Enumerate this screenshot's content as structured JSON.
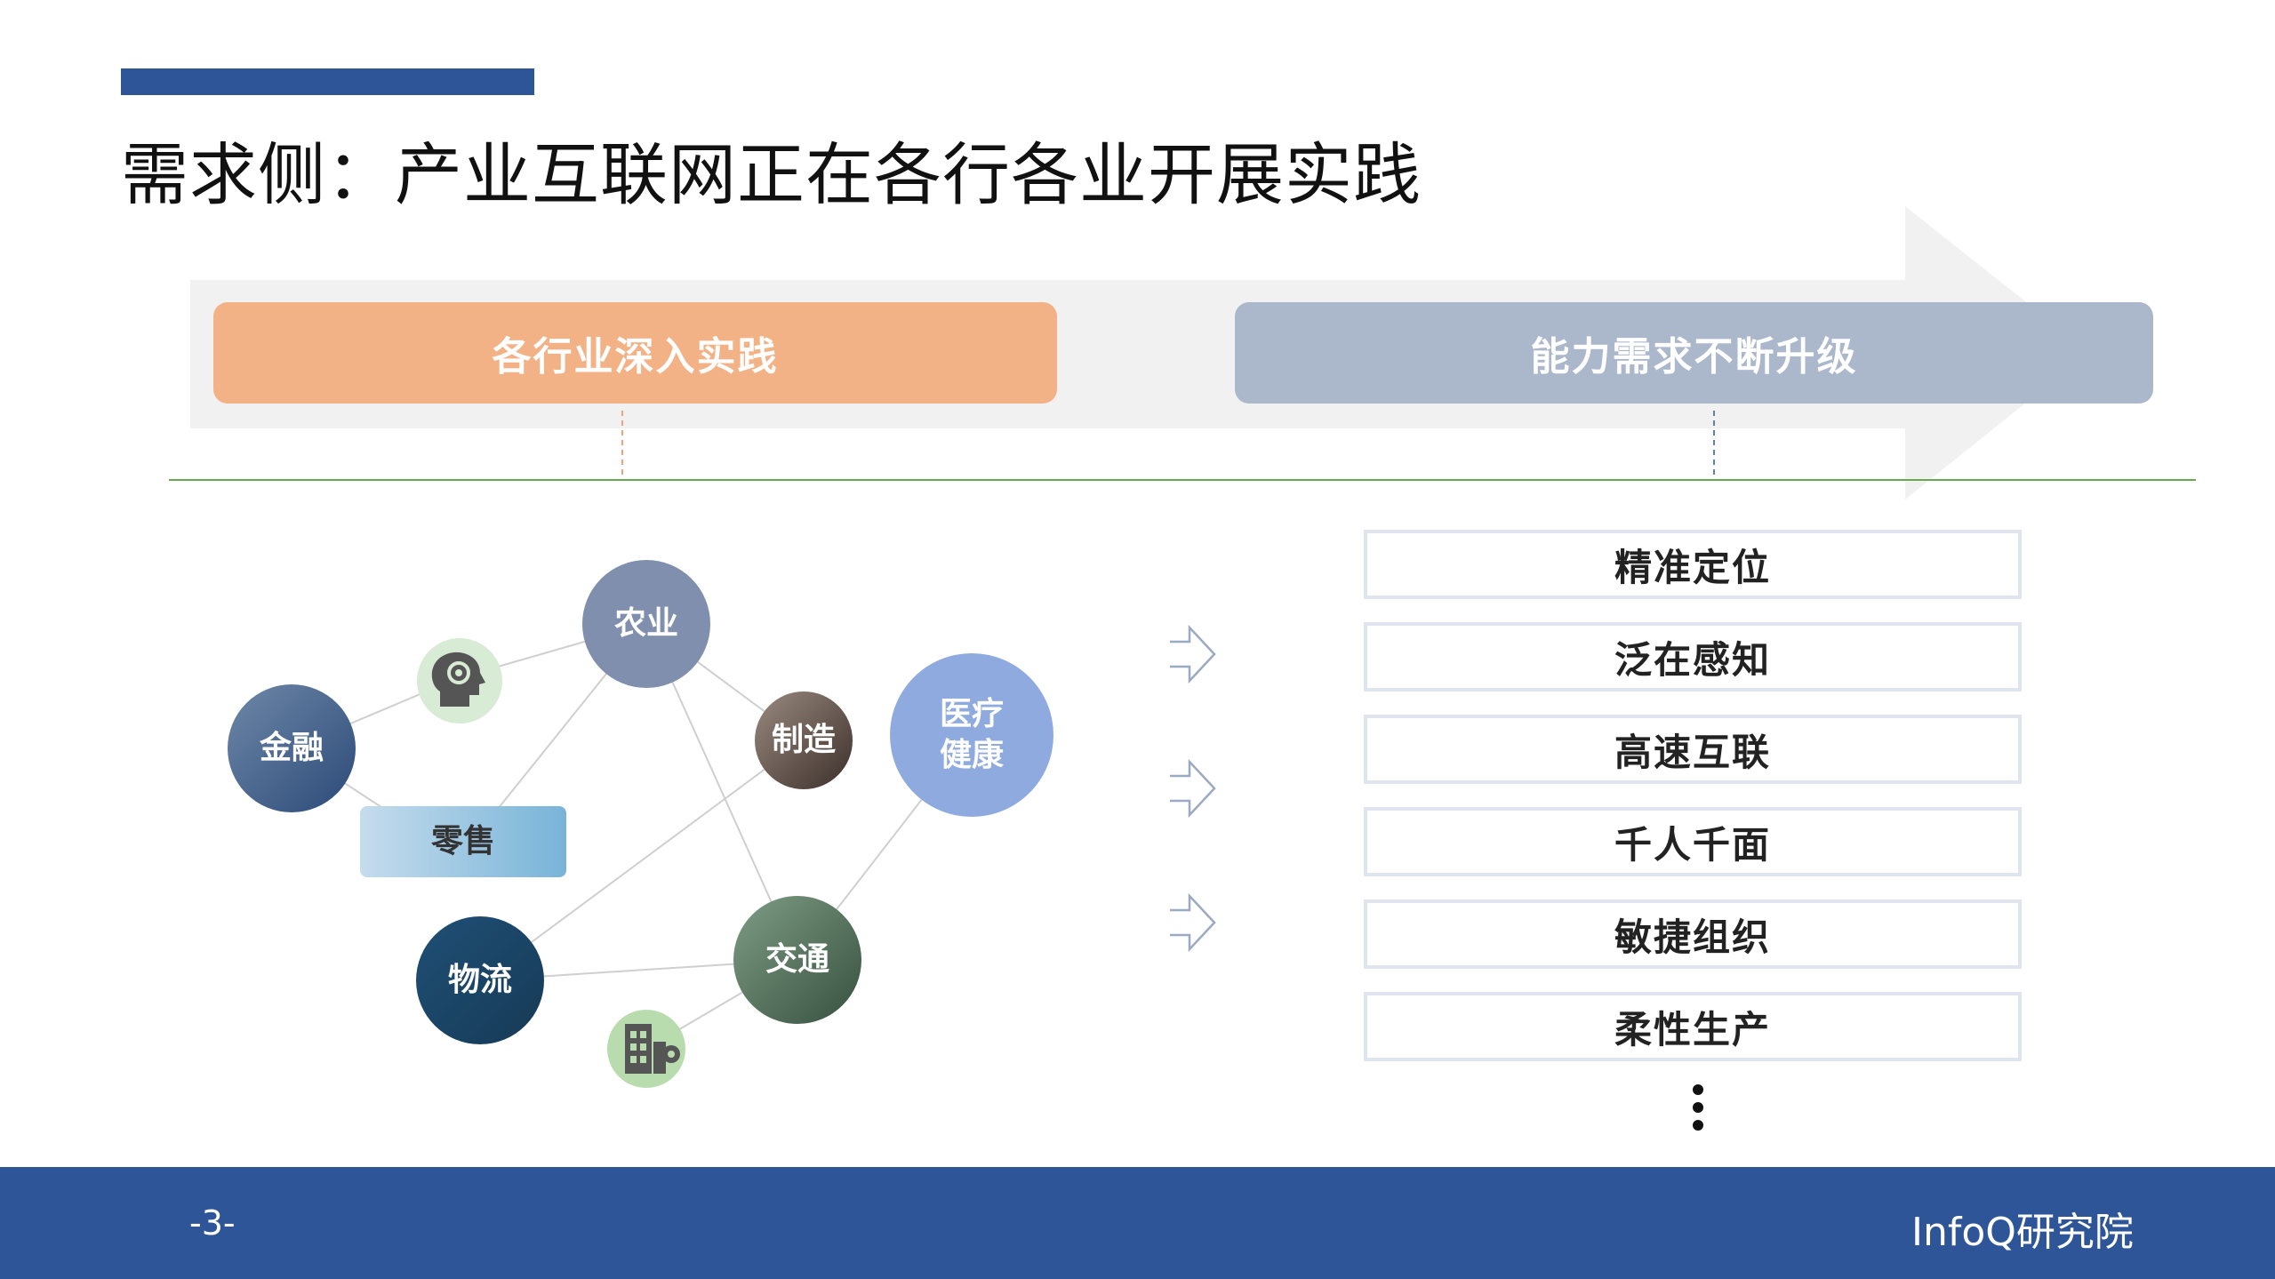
{
  "title": "需求侧：产业互联网正在各行各业开展实践",
  "banner": {
    "left_label": "各行业深入实践",
    "right_label": "能力需求不断升级"
  },
  "industries": {
    "agriculture": "农业",
    "finance": "金融",
    "manufacturing": "制造",
    "healthcare_line1": "医疗",
    "healthcare_line2": "健康",
    "retail": "零售",
    "logistics": "物流",
    "transport": "交通"
  },
  "capabilities": [
    "精准定位",
    "泛在感知",
    "高速互联",
    "千人千面",
    "敏捷组织",
    "柔性生产"
  ],
  "footer": {
    "page": "-3-",
    "brand": "InfoQ研究院"
  },
  "colors": {
    "accent": "#2e5597",
    "left_pill": "#f3b186",
    "right_pill": "#abb7ca"
  }
}
